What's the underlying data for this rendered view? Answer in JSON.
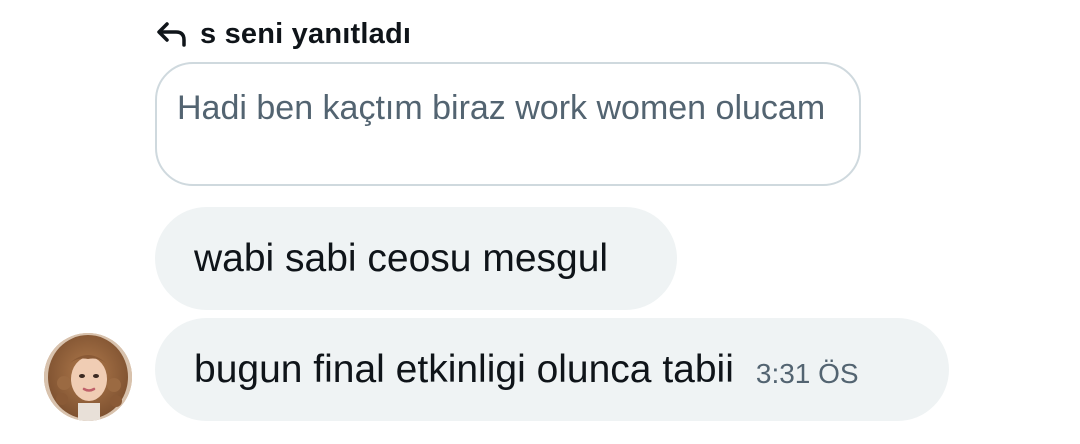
{
  "reply": {
    "header_label": "s seni yanıtladı",
    "icon": "reply-arrow-icon",
    "quoted_text": "Hadi ben kaçtım biraz work women olucam"
  },
  "messages": [
    {
      "text": "wabi sabi ceosu mesgul"
    },
    {
      "text": "bugun final etkinligi olunca tabii",
      "time": "3:31 ÖS"
    }
  ],
  "colors": {
    "bubble_bg": "#eff3f4",
    "quote_border": "#cfd9de",
    "secondary_text": "#536471",
    "primary_text": "#0f1419"
  }
}
